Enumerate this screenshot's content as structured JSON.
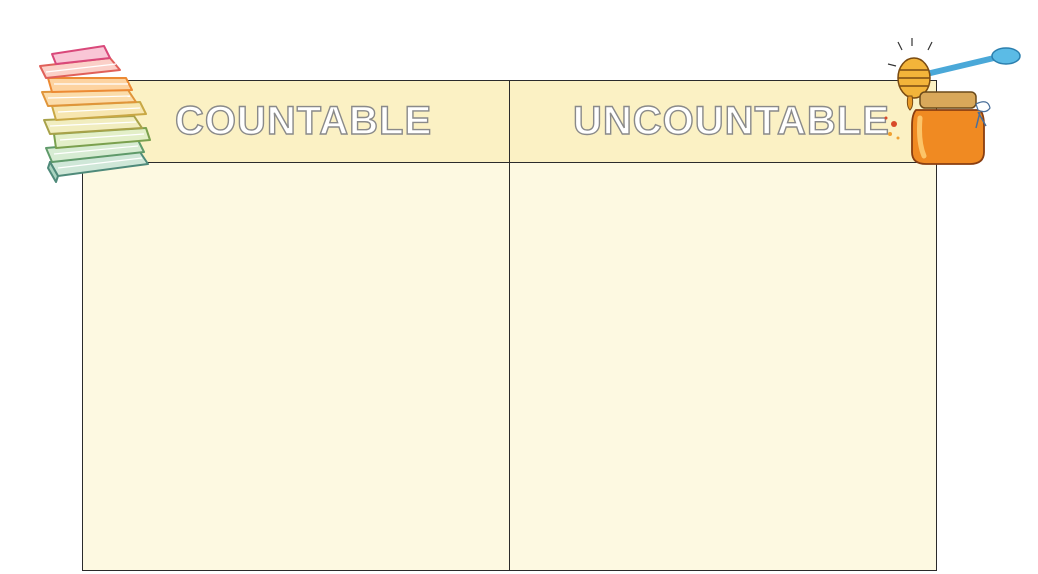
{
  "columns": {
    "left_header": "COUNTABLE",
    "right_header": "UNCOUNTABLE"
  },
  "icons": {
    "left": "books-stack-icon",
    "right": "honey-jar-icon"
  },
  "colors": {
    "header_fill": "#fbf1c4",
    "body_fill": "#fdf9e1",
    "border": "#2b2b2b",
    "text_outline": "#8a8a8a"
  }
}
